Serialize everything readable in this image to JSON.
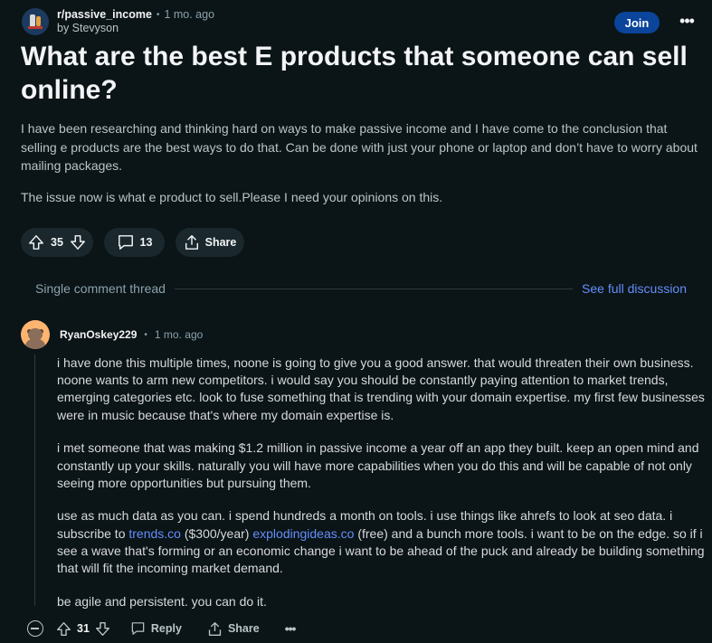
{
  "post": {
    "subreddit": "r/passive_income",
    "time_ago": "1 mo. ago",
    "author": "by Stevyson",
    "join_label": "Join",
    "more_label": "•••",
    "title": "What are the best E products that someone can sell online?",
    "body": [
      "I have been researching and thinking hard on ways to make passive income and I have come to the conclusion that selling e products are the best ways to do that. Can be done with just your phone or laptop and don’t have to worry about mailing packages.",
      "The issue now is what e product to sell.Please I need your opinions on this."
    ],
    "votes": "35",
    "comments": "13",
    "share_label": "Share"
  },
  "thread": {
    "label": "Single comment thread",
    "link": "See full discussion"
  },
  "comment": {
    "user": "RyanOskey229",
    "time_ago": "1 mo. ago",
    "p1": "i have done this multiple times, noone is going to give you a good answer. that would threaten their own business. noone wants to arm new competitors. i would say you should be constantly paying attention to market trends, emerging categories etc. look to fuse something that is trending with your domain expertise. my first few businesses were in music because that's where my domain expertise is.",
    "p2": "i met someone that was making $1.2 million in passive income a year off an app they built. keep an open mind and constantly up your skills. naturally you will have more capabilities when you do this and will be capable of not only seeing more opportunities but pursuing them.",
    "p3_a": "use as much data as you can. i spend hundreds a month on tools. i use things like ahrefs to look at seo data. i subscribe to ",
    "p3_link1": "trends.co",
    "p3_b": " ($300/year) ",
    "p3_link2": "explodingideas.co",
    "p3_c": " (free) and a bunch more tools. i want to be on the edge. so if i see a wave that's forming or an economic change i want to be ahead of the puck and already be building something that will fit the incoming market demand.",
    "p4": "be agile and persistent. you can do it.",
    "votes": "31",
    "reply_label": "Reply",
    "share_label": "Share",
    "more_label": "•••"
  },
  "colors": {
    "background": "#0b1416",
    "join_button": "#0a449b",
    "link": "#648efc",
    "pill": "#1a282d"
  }
}
